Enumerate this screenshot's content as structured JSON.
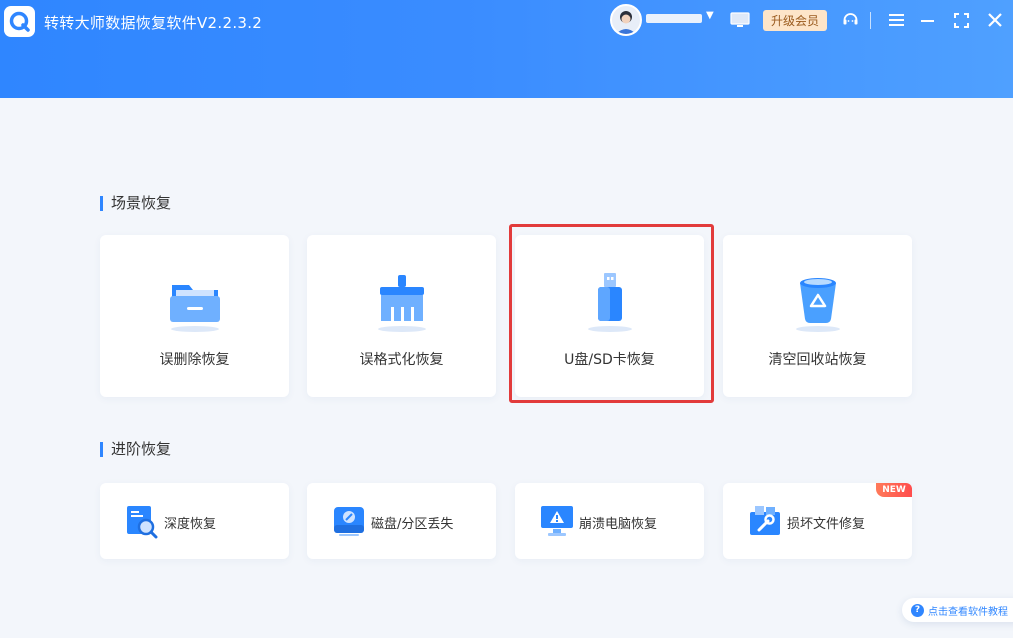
{
  "titlebar": {
    "title": "转转大师数据恢复软件V2.2.3.2",
    "vip_label": "升级会员",
    "colors": {
      "header_start": "#2f86ff",
      "header_end": "#4fa0ff",
      "vip_bg": "#fde5c9"
    }
  },
  "scene_section": {
    "title": "场景恢复",
    "cards": [
      {
        "label": "误删除恢复",
        "icon": "folder-icon"
      },
      {
        "label": "误格式化恢复",
        "icon": "broom-icon"
      },
      {
        "label": "U盘/SD卡恢复",
        "icon": "usb-drive-icon"
      },
      {
        "label": "清空回收站恢复",
        "icon": "recycle-bin-icon"
      }
    ]
  },
  "advanced_section": {
    "title": "进阶恢复",
    "cards": [
      {
        "label": "深度恢复",
        "icon": "deep-scan-icon"
      },
      {
        "label": "磁盘/分区丢失",
        "icon": "disk-icon"
      },
      {
        "label": "崩溃电脑恢复",
        "icon": "crashed-pc-icon"
      },
      {
        "label": "损坏文件修复",
        "icon": "file-repair-icon",
        "badge": "NEW"
      }
    ]
  },
  "footer": {
    "tutorial_label": "点击查看软件教程"
  },
  "accent_color": "#2f86ff",
  "highlight_color": "#e23b3b"
}
